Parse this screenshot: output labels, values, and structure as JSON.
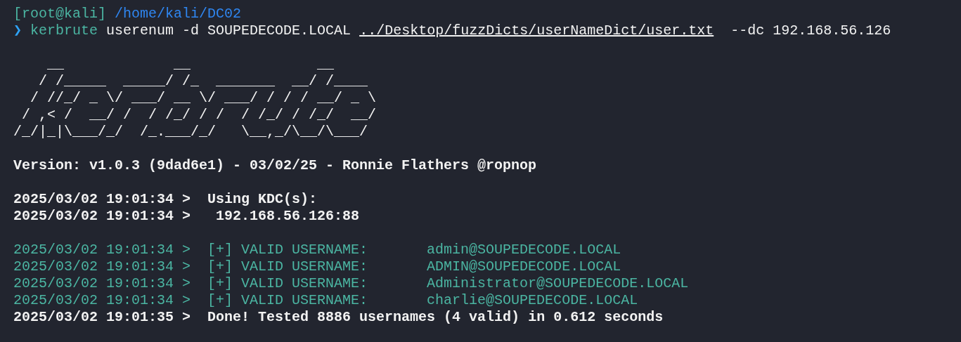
{
  "prompt": {
    "user_host": "[root@kali]",
    "cwd": "/home/kali/DC02",
    "symbol": "❯"
  },
  "command": {
    "program": "kerbrute",
    "args": "userenum -d SOUPEDECODE.LOCAL",
    "path": "../Desktop/fuzzDicts/userNameDict/user.txt",
    "tail": " --dc 192.168.56.126"
  },
  "banner": [
    "    __             __               __",
    "   / /_____  _____/ /_  _______  __/ /____",
    "  / //_/ _ \\/ ___/ __ \\/ ___/ / / / __/ _ \\",
    " / ,< /  __/ /  / /_/ / /  / /_/ / /_/  __/",
    "/_/|_|\\___/_/  /_.___/_/   \\__,_/\\__/\\___/"
  ],
  "version": "Version: v1.0.3 (9dad6e1) - 03/02/25 - Ronnie Flathers @ropnop",
  "log_groups": [
    [
      {
        "kind": "info",
        "timestamp": "2025/03/02 19:01:34 >",
        "message": " Using KDC(s):"
      },
      {
        "kind": "info",
        "timestamp": "2025/03/02 19:01:34 >",
        "message": "  192.168.56.126:88"
      }
    ],
    [
      {
        "kind": "valid",
        "timestamp": "2025/03/02 19:01:34 >",
        "message": " [+] VALID USERNAME:",
        "username": "admin@SOUPEDECODE.LOCAL"
      },
      {
        "kind": "valid",
        "timestamp": "2025/03/02 19:01:34 >",
        "message": " [+] VALID USERNAME:",
        "username": "ADMIN@SOUPEDECODE.LOCAL"
      },
      {
        "kind": "valid",
        "timestamp": "2025/03/02 19:01:34 >",
        "message": " [+] VALID USERNAME:",
        "username": "Administrator@SOUPEDECODE.LOCAL"
      },
      {
        "kind": "valid",
        "timestamp": "2025/03/02 19:01:34 >",
        "message": " [+] VALID USERNAME:",
        "username": "charlie@SOUPEDECODE.LOCAL"
      },
      {
        "kind": "done",
        "timestamp": "2025/03/02 19:01:35 >",
        "message": " Done! Tested 8886 usernames (4 valid) in 0.612 seconds"
      }
    ]
  ]
}
